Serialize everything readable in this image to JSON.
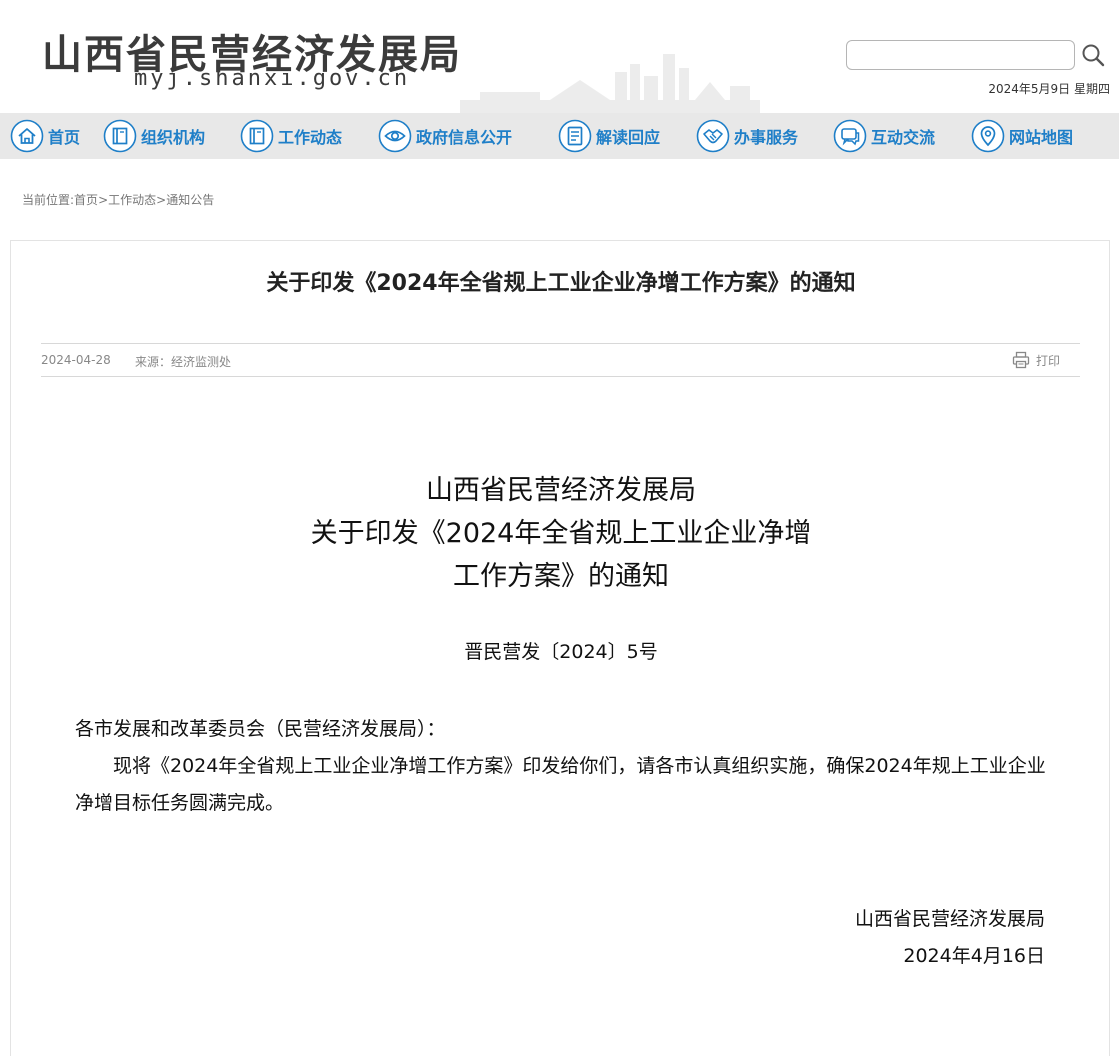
{
  "header": {
    "site_title": "山西省民营经济发展局",
    "site_url": "myj.shanxi.gov.cn",
    "search_placeholder": "",
    "date": "2024年5月9日 星期四"
  },
  "nav": {
    "items": [
      {
        "label": "首页",
        "icon": "home-icon"
      },
      {
        "label": "组织机构",
        "icon": "book-icon"
      },
      {
        "label": "工作动态",
        "icon": "book-icon"
      },
      {
        "label": "政府信息公开",
        "icon": "eye-icon"
      },
      {
        "label": "解读回应",
        "icon": "document-icon"
      },
      {
        "label": "办事服务",
        "icon": "handshake-icon"
      },
      {
        "label": "互动交流",
        "icon": "chat-icon"
      },
      {
        "label": "网站地图",
        "icon": "map-pin-icon"
      }
    ],
    "accent_color": "#1f7fc8",
    "bar_color": "#e8e8e8"
  },
  "breadcrumb": {
    "prefix": "当前位置:",
    "items": [
      "首页",
      "工作动态",
      "通知公告"
    ],
    "separator": ">"
  },
  "article": {
    "title": "关于印发《2024年全省规上工业企业净增工作方案》的通知",
    "date": "2024-04-28",
    "source": "来源：经济监测处",
    "print_label": "打印",
    "doc_heading_lines": [
      "山西省民营经济发展局",
      "关于印发《2024年全省规上工业企业净增",
      "工作方案》的通知"
    ],
    "doc_number": "晋民营发〔2024〕5号",
    "salutation": "各市发展和改革委员会（民营经济发展局）：",
    "body": "现将《2024年全省规上工业企业净增工作方案》印发给你们，请各市认真组织实施，确保2024年规上工业企业净增目标任务圆满完成。",
    "signature_org": "山西省民营经济发展局",
    "signature_date": "2024年4月16日"
  }
}
